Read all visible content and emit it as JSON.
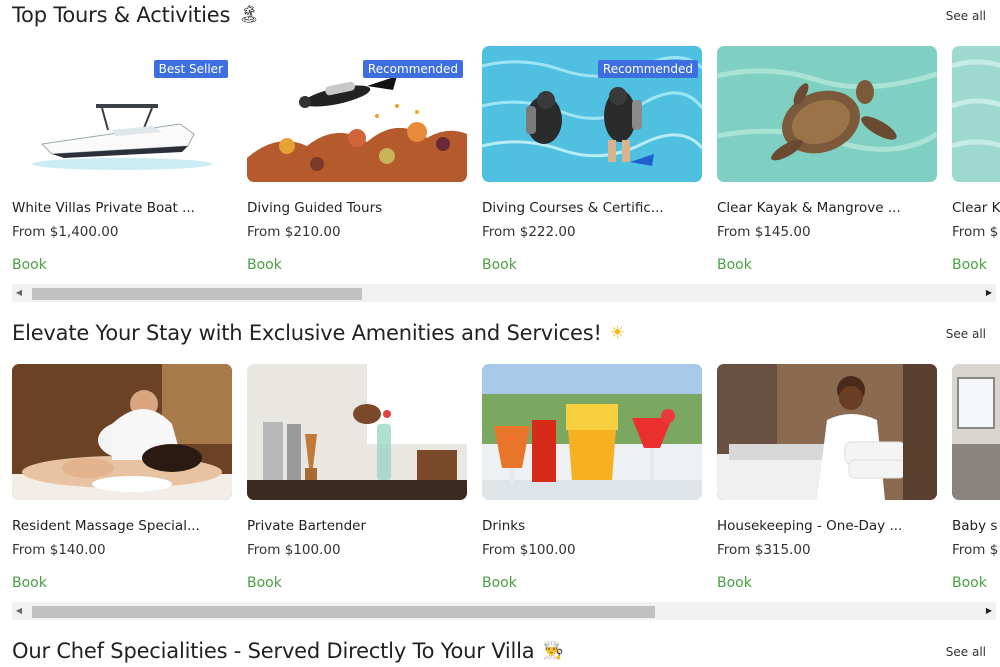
{
  "colors": {
    "book": "#4aa043",
    "badge": "#3d6fe0",
    "scroll_thumb": "#c1c1c1"
  },
  "sections": [
    {
      "title": "Top Tours & Activities",
      "emoji": "🏝",
      "see_all": "See all",
      "scroll_position": 0.35,
      "cards": [
        {
          "title": "White Villas Private Boat ...",
          "price": "From $1,400.00",
          "book": "Book",
          "badge": "Best Seller",
          "image": "speedboat-image"
        },
        {
          "title": "Diving Guided Tours",
          "price": "From $210.00",
          "book": "Book",
          "badge": "Recommended",
          "image": "reef-diver-image"
        },
        {
          "title": "Diving Courses & Certific...",
          "price": "From $222.00",
          "book": "Book",
          "badge": "Recommended",
          "image": "pool-divers-image"
        },
        {
          "title": "Clear Kayak & Mangrove ...",
          "price": "From $145.00",
          "book": "Book",
          "badge": "",
          "image": "sea-turtle-image"
        },
        {
          "title": "Clear K",
          "price": "From $",
          "book": "Book",
          "badge": "",
          "image": "shallow-water-image"
        }
      ]
    },
    {
      "title": "Elevate Your Stay with Exclusive Amenities and Services!",
      "emoji": "☀",
      "see_all": "See all",
      "scroll_position": 0.66,
      "cards": [
        {
          "title": "Resident Massage Special...",
          "price": "From $140.00",
          "book": "Book",
          "badge": "",
          "image": "massage-image"
        },
        {
          "title": "Private Bartender",
          "price": "From $100.00",
          "book": "Book",
          "badge": "",
          "image": "bartender-image"
        },
        {
          "title": "Drinks",
          "price": "From $100.00",
          "book": "Book",
          "badge": "",
          "image": "cocktails-image"
        },
        {
          "title": "Housekeeping - One-Day ...",
          "price": "From $315.00",
          "book": "Book",
          "badge": "",
          "image": "housekeeper-image"
        },
        {
          "title": "Baby s",
          "price": "From $",
          "book": "Book",
          "badge": "",
          "image": "room-image"
        }
      ]
    },
    {
      "title": "Our Chef Specialities - Served Directly To Your Villa",
      "emoji": "👨‍🍳",
      "see_all": "See all"
    }
  ]
}
